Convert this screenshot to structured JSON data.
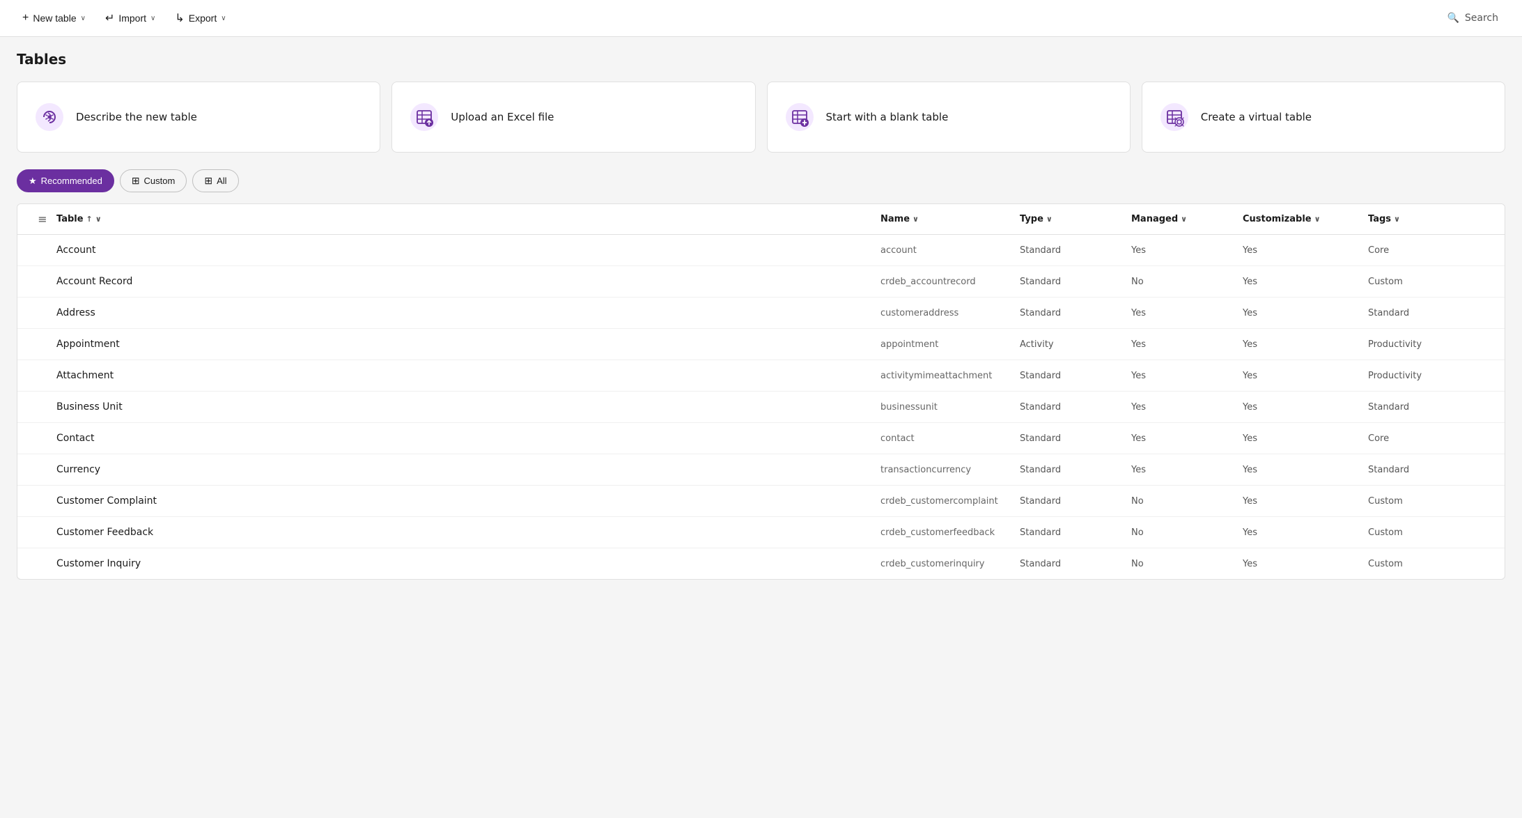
{
  "topbar": {
    "new_table_label": "New table",
    "import_label": "Import",
    "export_label": "Export",
    "search_label": "Search",
    "new_table_icon": "+",
    "import_icon": "↵",
    "export_icon": "↳"
  },
  "page": {
    "title": "Tables"
  },
  "cards": [
    {
      "id": "describe",
      "label": "Describe the new table",
      "icon_type": "describe"
    },
    {
      "id": "upload",
      "label": "Upload an Excel file",
      "icon_type": "upload"
    },
    {
      "id": "blank",
      "label": "Start with a blank table",
      "icon_type": "blank"
    },
    {
      "id": "virtual",
      "label": "Create a virtual table",
      "icon_type": "virtual"
    }
  ],
  "filters": [
    {
      "id": "recommended",
      "label": "Recommended",
      "active": true,
      "icon": "★"
    },
    {
      "id": "custom",
      "label": "Custom",
      "active": false,
      "icon": "⊞"
    },
    {
      "id": "all",
      "label": "All",
      "active": false,
      "icon": "⊞"
    }
  ],
  "table": {
    "columns": [
      {
        "id": "table",
        "label": "Table",
        "sort": "asc"
      },
      {
        "id": "name",
        "label": "Name",
        "sort": "desc"
      },
      {
        "id": "type",
        "label": "Type",
        "sort": "none"
      },
      {
        "id": "managed",
        "label": "Managed",
        "sort": "none"
      },
      {
        "id": "customizable",
        "label": "Customizable",
        "sort": "none"
      },
      {
        "id": "tags",
        "label": "Tags",
        "sort": "none"
      }
    ],
    "rows": [
      {
        "table": "Account",
        "name": "account",
        "type": "Standard",
        "managed": "Yes",
        "customizable": "Yes",
        "tags": "Core"
      },
      {
        "table": "Account Record",
        "name": "crdeb_accountrecord",
        "type": "Standard",
        "managed": "No",
        "customizable": "Yes",
        "tags": "Custom"
      },
      {
        "table": "Address",
        "name": "customeraddress",
        "type": "Standard",
        "managed": "Yes",
        "customizable": "Yes",
        "tags": "Standard"
      },
      {
        "table": "Appointment",
        "name": "appointment",
        "type": "Activity",
        "managed": "Yes",
        "customizable": "Yes",
        "tags": "Productivity"
      },
      {
        "table": "Attachment",
        "name": "activitymimeattachment",
        "type": "Standard",
        "managed": "Yes",
        "customizable": "Yes",
        "tags": "Productivity"
      },
      {
        "table": "Business Unit",
        "name": "businessunit",
        "type": "Standard",
        "managed": "Yes",
        "customizable": "Yes",
        "tags": "Standard"
      },
      {
        "table": "Contact",
        "name": "contact",
        "type": "Standard",
        "managed": "Yes",
        "customizable": "Yes",
        "tags": "Core"
      },
      {
        "table": "Currency",
        "name": "transactioncurrency",
        "type": "Standard",
        "managed": "Yes",
        "customizable": "Yes",
        "tags": "Standard"
      },
      {
        "table": "Customer Complaint",
        "name": "crdeb_customercomplaint",
        "type": "Standard",
        "managed": "No",
        "customizable": "Yes",
        "tags": "Custom"
      },
      {
        "table": "Customer Feedback",
        "name": "crdeb_customerfeedback",
        "type": "Standard",
        "managed": "No",
        "customizable": "Yes",
        "tags": "Custom"
      },
      {
        "table": "Customer Inquiry",
        "name": "crdeb_customerinquiry",
        "type": "Standard",
        "managed": "No",
        "customizable": "Yes",
        "tags": "Custom"
      }
    ]
  },
  "icons": {
    "chevron_down": "∨",
    "sort_asc": "↑",
    "sort_desc": "↓",
    "menu_dots": "⋮",
    "list_view": "≡"
  }
}
